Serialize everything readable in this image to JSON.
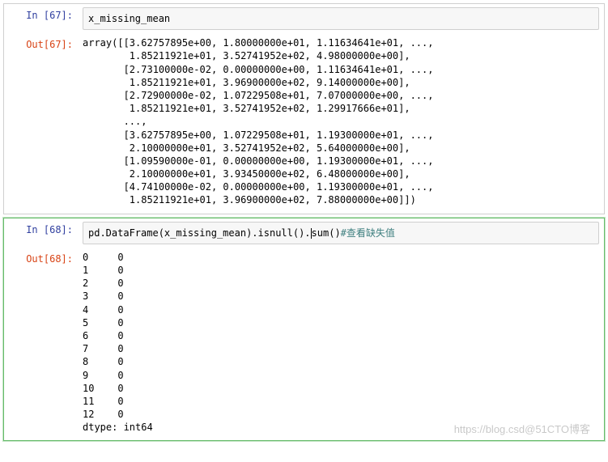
{
  "cells": [
    {
      "in_prompt": "In [67]:",
      "out_prompt": "Out[67]:",
      "input_code": "x_missing_mean",
      "input_comment": "",
      "output_text": "array([[3.62757895e+00, 1.80000000e+01, 1.11634641e+01, ...,\n        1.85211921e+01, 3.52741952e+02, 4.98000000e+00],\n       [2.73100000e-02, 0.00000000e+00, 1.11634641e+01, ...,\n        1.85211921e+01, 3.96900000e+02, 9.14000000e+00],\n       [2.72900000e-02, 1.07229508e+01, 7.07000000e+00, ...,\n        1.85211921e+01, 3.52741952e+02, 1.29917666e+01],\n       ...,\n       [3.62757895e+00, 1.07229508e+01, 1.19300000e+01, ...,\n        2.10000000e+01, 3.52741952e+02, 5.64000000e+00],\n       [1.09590000e-01, 0.00000000e+00, 1.19300000e+01, ...,\n        2.10000000e+01, 3.93450000e+02, 6.48000000e+00],\n       [4.74100000e-02, 0.00000000e+00, 1.19300000e+01, ...,\n        1.85211921e+01, 3.96900000e+02, 7.88000000e+00]])"
    },
    {
      "in_prompt": "In [68]:",
      "out_prompt": "Out[68]:",
      "input_code": "pd.DataFrame(x_missing_mean).isnull().",
      "input_after_cursor": "sum()",
      "input_comment": "#查看缺失值",
      "output_text": "0     0\n1     0\n2     0\n3     0\n4     0\n5     0\n6     0\n7     0\n8     0\n9     0\n10    0\n11    0\n12    0\ndtype: int64"
    }
  ],
  "watermark": "https://blog.csd@51CTO博客"
}
